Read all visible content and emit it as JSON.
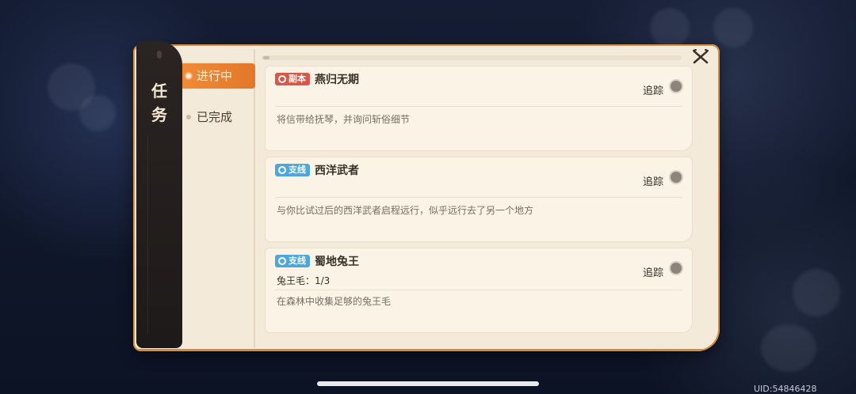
{
  "window": {
    "title": "任务",
    "title_lines": [
      "任",
      "务"
    ]
  },
  "tabs": [
    {
      "label": "进行中",
      "active": true
    },
    {
      "label": "已完成",
      "active": false
    }
  ],
  "quests": [
    {
      "badge": "副本",
      "badge_color": "#dc5648",
      "name": "燕归无期",
      "progress": "",
      "description": "将信带给抚琴，并询问斩俗细节",
      "track_label": "追踪"
    },
    {
      "badge": "支线",
      "badge_color": "#4ca8dc",
      "name": "西洋武者",
      "progress": "",
      "description": "与你比试过后的西洋武者启程远行，似乎远行去了另一个地方",
      "track_label": "追踪"
    },
    {
      "badge": "支线",
      "badge_color": "#4ca8dc",
      "name": "蜀地兔王",
      "progress": "兔王毛：1/3",
      "description": "在森林中收集足够的兔王毛",
      "track_label": "追踪"
    }
  ],
  "footer": {
    "uid": "UID:54846428"
  },
  "icons": {
    "close": "close-icon",
    "badge": "target-icon",
    "radio": "radio-icon"
  },
  "colors": {
    "accent": "#e98332",
    "panel": "#f4ead9",
    "strip": "#231e1c"
  }
}
